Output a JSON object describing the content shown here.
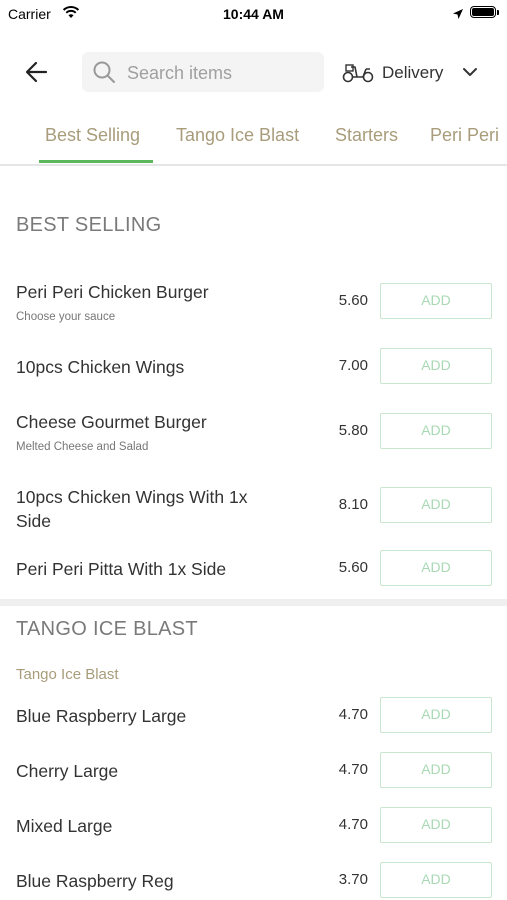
{
  "status_bar": {
    "carrier": "Carrier",
    "time": "10:44 AM"
  },
  "header": {
    "search_placeholder": "Search items",
    "delivery_label": "Delivery"
  },
  "tabs": [
    {
      "label": "Best Selling"
    },
    {
      "label": "Tango Ice Blast"
    },
    {
      "label": "Starters"
    },
    {
      "label": "Peri Peri"
    }
  ],
  "sections": {
    "best_selling": {
      "title": "BEST SELLING",
      "items": [
        {
          "name": "Peri Peri Chicken Burger",
          "description": "Choose your sauce",
          "price": "5.60",
          "button": "ADD"
        },
        {
          "name": "10pcs Chicken Wings",
          "price": "7.00",
          "button": "ADD"
        },
        {
          "name": "Cheese Gourmet Burger",
          "description": "Melted Cheese and Salad",
          "price": "5.80",
          "button": "ADD"
        },
        {
          "name": "10pcs Chicken Wings With 1x Side",
          "price": "8.10",
          "button": "ADD"
        },
        {
          "name": "Peri Peri Pitta With 1x Side",
          "price": "5.60",
          "button": "ADD"
        }
      ]
    },
    "tango_ice_blast": {
      "title": "TANGO ICE BLAST",
      "subtitle": "Tango Ice Blast",
      "items": [
        {
          "name": "Blue Raspberry Large",
          "price": "4.70",
          "button": "ADD"
        },
        {
          "name": "Cherry Large",
          "price": "4.70",
          "button": "ADD"
        },
        {
          "name": "Mixed Large",
          "price": "4.70",
          "button": "ADD"
        },
        {
          "name": "Blue Raspberry Reg",
          "price": "3.70",
          "button": "ADD"
        }
      ]
    }
  },
  "colors": {
    "accent": "#5cb85c",
    "tab_text": "#a89c7b",
    "add_border": "#c9e6cf",
    "add_text": "#a9d9b4"
  }
}
